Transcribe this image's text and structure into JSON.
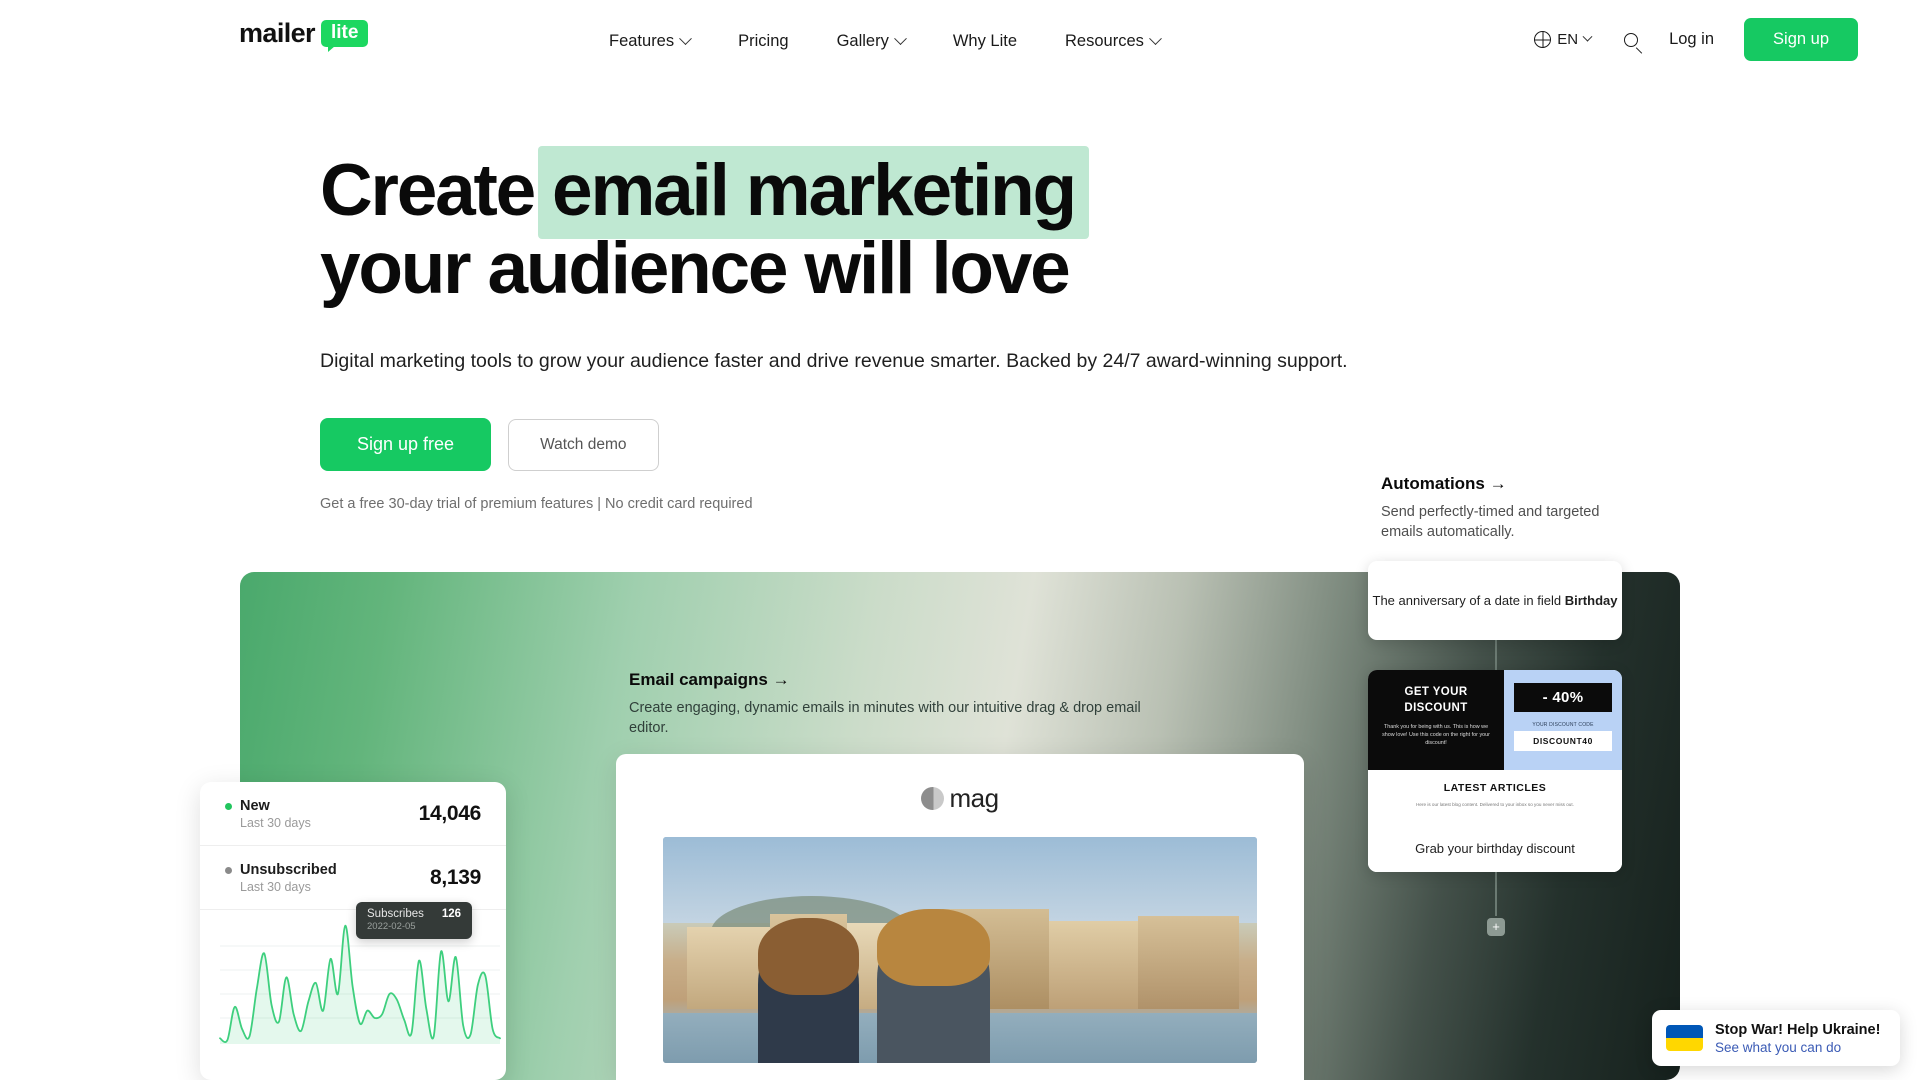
{
  "header": {
    "logo": {
      "primary": "mailer",
      "badge": "lite"
    },
    "nav": [
      {
        "label": "Features",
        "has_dropdown": true
      },
      {
        "label": "Pricing",
        "has_dropdown": false
      },
      {
        "label": "Gallery",
        "has_dropdown": true
      },
      {
        "label": "Why Lite",
        "has_dropdown": false
      },
      {
        "label": "Resources",
        "has_dropdown": true
      }
    ],
    "language": "EN",
    "login_label": "Log in",
    "signup_label": "Sign up",
    "accent_color": "#16c962"
  },
  "hero": {
    "heading_part1": "Create",
    "heading_highlight": "email marketing",
    "heading_part2": "your audience will love",
    "highlight_color": "#bfe8d2",
    "subtitle": "Digital marketing tools to grow your audience faster and drive revenue smarter. Backed by 24/7 award-winning support.",
    "primary_cta": "Sign up free",
    "secondary_cta": "Watch demo",
    "note": "Get a free 30-day trial of premium features | No credit card required"
  },
  "automations": {
    "title": "Automations →",
    "description": "Send perfectly-timed and targeted emails automatically."
  },
  "campaigns": {
    "title": "Email campaigns →",
    "description": "Create engaging, dynamic emails in minutes with our intuitive drag & drop email editor."
  },
  "email_preview": {
    "brand": "mag"
  },
  "stats": {
    "rows": [
      {
        "label": "New",
        "period": "Last 30 days",
        "value": "14,046",
        "dot_color": "#22c55e"
      },
      {
        "label": "Unsubscribed",
        "period": "Last 30 days",
        "value": "8,139",
        "dot_color": "#8a8a8a"
      }
    ],
    "tooltip": {
      "label": "Subscribes",
      "value": "126",
      "date": "2022-02-05"
    }
  },
  "chart_data": {
    "type": "area",
    "title": "Subscribes",
    "xlabel": "",
    "ylabel": "",
    "series": [
      {
        "name": "Subscribes",
        "color": "#3ecf7e",
        "values": [
          4,
          2,
          38,
          14,
          6,
          58,
          96,
          40,
          22,
          70,
          30,
          12,
          44,
          64,
          34,
          90,
          52,
          126,
          60,
          20,
          34,
          26,
          30,
          52,
          46,
          24,
          10,
          88,
          36,
          6,
          98,
          44,
          92,
          18,
          8,
          62,
          72,
          14,
          4
        ]
      }
    ],
    "ylim": [
      0,
      130
    ],
    "grid": true,
    "legend_position": "none",
    "annotation": {
      "label": "Subscribes",
      "value": 126,
      "date": "2022-02-05"
    }
  },
  "automation_flow": {
    "trigger_card": {
      "text_prefix": "The anniversary of a date in field ",
      "text_bold": "Birthday"
    },
    "email_card": {
      "promo_heading": "GET YOUR DISCOUNT",
      "promo_body": "Thank you for being with us. This is how we show love! Use this code on the right for your discount!",
      "discount_badge": "- 40%",
      "code_caption": "YOUR DISCOUNT CODE",
      "discount_code": "DISCOUNT40",
      "articles_heading": "LATEST ARTICLES",
      "articles_body": "Here is our latest blog content. Delivered to your inbox so you never miss out.",
      "footer_label": "Grab your birthday discount"
    },
    "add_node_label": "+"
  },
  "ukraine_banner": {
    "title": "Stop War! Help Ukraine!",
    "link": "See what you can do",
    "link_color": "#3b5bb5"
  }
}
